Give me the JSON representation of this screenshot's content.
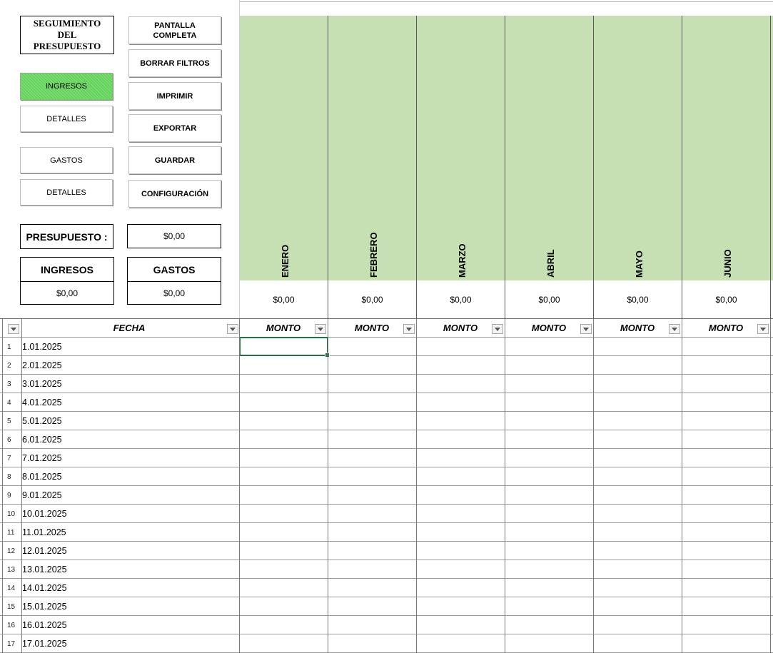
{
  "title": "SEGUIMIENTO\nDEL\nPRESUPUESTO",
  "buttons": {
    "ingresos": "INGRESOS",
    "detalles_ingresos": "DETALLES",
    "gastos": "GASTOS",
    "detalles_gastos": "DETALLES",
    "pantalla_completa": "PANTALLA\nCOMPLETA",
    "borrar_filtros": "BORRAR FILTROS",
    "imprimir": "IMPRIMIR",
    "exportar": "EXPORTAR",
    "guardar": "GUARDAR",
    "configuracion": "CONFIGURACIÓN"
  },
  "summary": {
    "presupuesto_label": "PRESUPUESTO :",
    "presupuesto_value": "$0,00",
    "ingresos_label": "INGRESOS",
    "ingresos_value": "$0,00",
    "gastos_label": "GASTOS",
    "gastos_value": "$0,00"
  },
  "months": [
    {
      "name": "ENERO",
      "total": "$0,00",
      "column": "MONTO"
    },
    {
      "name": "FEBRERO",
      "total": "$0,00",
      "column": "MONTO"
    },
    {
      "name": "MARZO",
      "total": "$0,00",
      "column": "MONTO"
    },
    {
      "name": "ABRIL",
      "total": "$0,00",
      "column": "MONTO"
    },
    {
      "name": "MAYO",
      "total": "$0,00",
      "column": "MONTO"
    },
    {
      "name": "JUNIO",
      "total": "$0,00",
      "column": "MONTO"
    }
  ],
  "table": {
    "date_header": "FECHA",
    "rows": [
      {
        "num": "1",
        "date": "1.01.2025"
      },
      {
        "num": "2",
        "date": "2.01.2025"
      },
      {
        "num": "3",
        "date": "3.01.2025"
      },
      {
        "num": "4",
        "date": "4.01.2025"
      },
      {
        "num": "5",
        "date": "5.01.2025"
      },
      {
        "num": "6",
        "date": "6.01.2025"
      },
      {
        "num": "7",
        "date": "7.01.2025"
      },
      {
        "num": "8",
        "date": "8.01.2025"
      },
      {
        "num": "9",
        "date": "9.01.2025"
      },
      {
        "num": "10",
        "date": "10.01.2025"
      },
      {
        "num": "11",
        "date": "11.01.2025"
      },
      {
        "num": "12",
        "date": "12.01.2025"
      },
      {
        "num": "13",
        "date": "13.01.2025"
      },
      {
        "num": "14",
        "date": "14.01.2025"
      },
      {
        "num": "15",
        "date": "15.01.2025"
      },
      {
        "num": "16",
        "date": "16.01.2025"
      },
      {
        "num": "17",
        "date": "17.01.2025"
      }
    ]
  },
  "colors": {
    "month_fill": "#c6e0b4",
    "active_button": "#66d35d",
    "selection": "#217346"
  }
}
